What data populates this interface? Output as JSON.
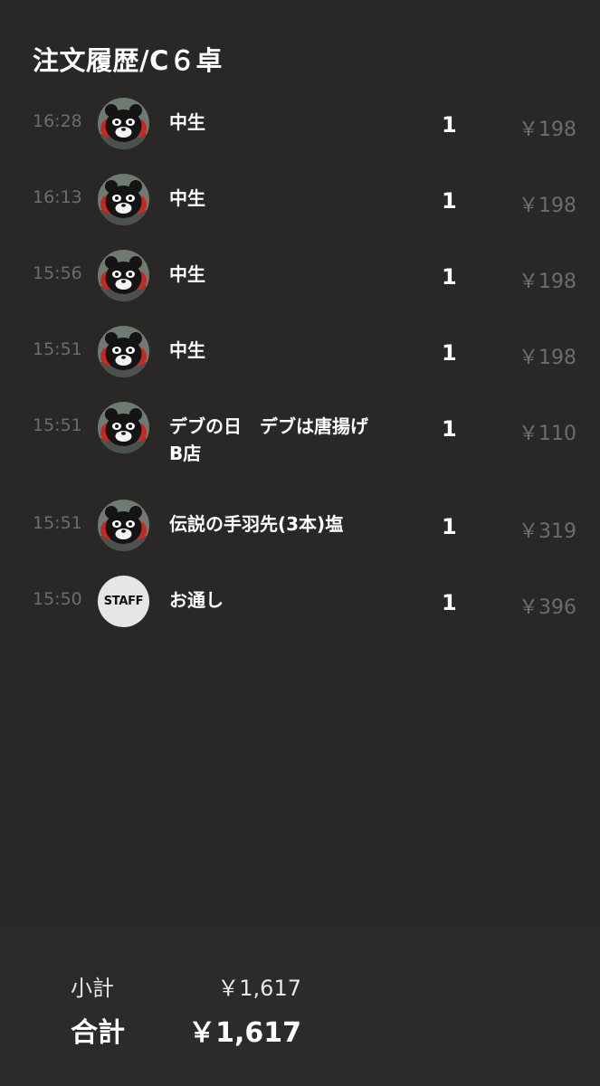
{
  "header": {
    "title": "注文履歴/C６卓"
  },
  "orders": [
    {
      "time": "16:28",
      "name": "中生",
      "qty": "1",
      "price": "￥198",
      "icon": "kumamon-avatar-icon"
    },
    {
      "time": "16:13",
      "name": "中生",
      "qty": "1",
      "price": "￥198",
      "icon": "kumamon-avatar-icon"
    },
    {
      "time": "15:56",
      "name": "中生",
      "qty": "1",
      "price": "￥198",
      "icon": "kumamon-avatar-icon"
    },
    {
      "time": "15:51",
      "name": "中生",
      "qty": "1",
      "price": "￥198",
      "icon": "kumamon-avatar-icon"
    },
    {
      "time": "15:51",
      "name": "デブの日　デブは唐揚げ　B店",
      "qty": "1",
      "price": "￥110",
      "icon": "kumamon-avatar-icon"
    },
    {
      "time": "15:51",
      "name": "伝説の手羽先(3本)塩",
      "qty": "1",
      "price": "￥319",
      "icon": "kumamon-avatar-icon"
    },
    {
      "time": "15:50",
      "name": "お通し",
      "qty": "1",
      "price": "￥396",
      "icon": "staff-avatar-icon",
      "avatar_text": "STAFF"
    }
  ],
  "summary": {
    "subtotal_label": "小計",
    "subtotal_value": "￥1,617",
    "total_label": "合計",
    "total_value": "￥1,617"
  },
  "colors": {
    "background": "#2a2727",
    "muted_text": "#6e6b6b",
    "primary_text": "#ffffff",
    "staff_avatar_bg": "#e6e6e6"
  }
}
